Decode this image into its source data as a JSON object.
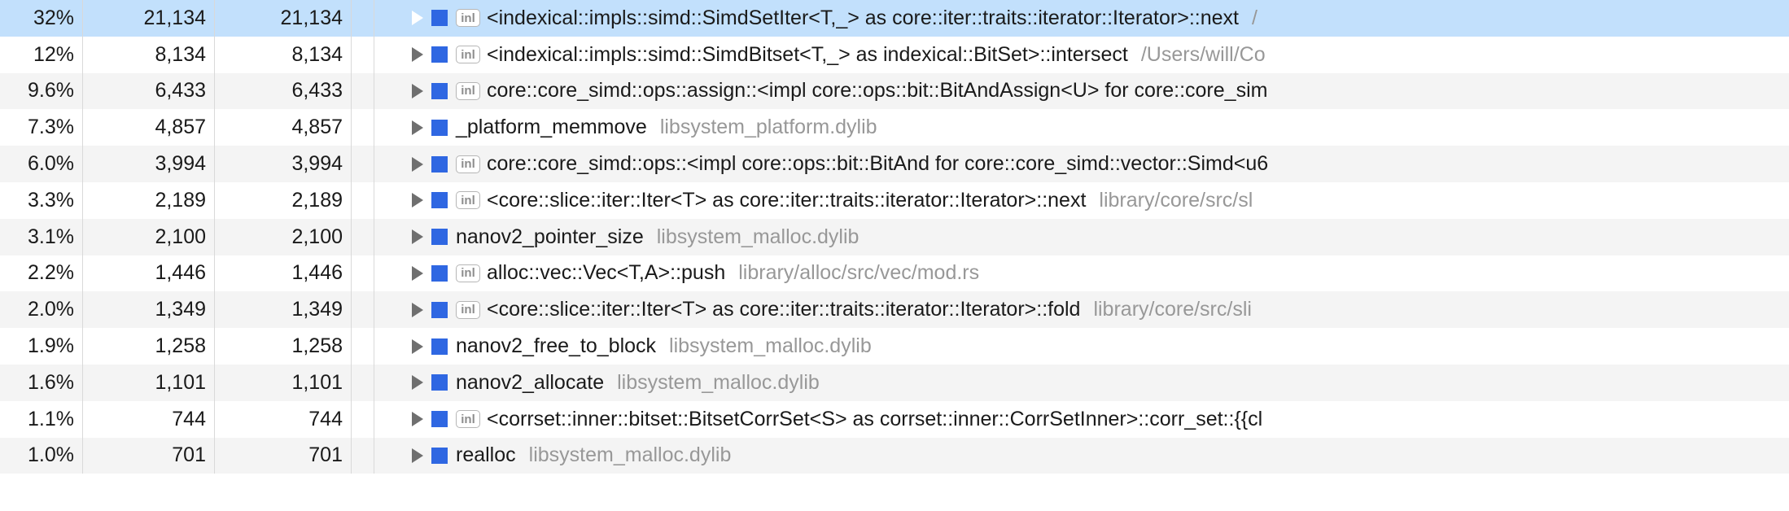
{
  "inl_label": "inl",
  "rows": [
    {
      "selected": true,
      "pct": "32%",
      "c1": "21,134",
      "c2": "21,134",
      "expanded": true,
      "inl": true,
      "symbol": "<indexical::impls::simd::SimdSetIter<T,_> as core::iter::traits::iterator::Iterator>::next",
      "path": "/"
    },
    {
      "selected": false,
      "pct": "12%",
      "c1": "8,134",
      "c2": "8,134",
      "expanded": false,
      "inl": true,
      "symbol": "<indexical::impls::simd::SimdBitset<T,_> as indexical::BitSet>::intersect",
      "path": "/Users/will/Co"
    },
    {
      "selected": false,
      "pct": "9.6%",
      "c1": "6,433",
      "c2": "6,433",
      "expanded": false,
      "inl": true,
      "symbol": "core::core_simd::ops::assign::<impl core::ops::bit::BitAndAssign<U> for core::core_sim",
      "path": ""
    },
    {
      "selected": false,
      "pct": "7.3%",
      "c1": "4,857",
      "c2": "4,857",
      "expanded": false,
      "inl": false,
      "symbol": "_platform_memmove",
      "path": "libsystem_platform.dylib"
    },
    {
      "selected": false,
      "pct": "6.0%",
      "c1": "3,994",
      "c2": "3,994",
      "expanded": false,
      "inl": true,
      "symbol": "core::core_simd::ops::<impl core::ops::bit::BitAnd for core::core_simd::vector::Simd<u6",
      "path": ""
    },
    {
      "selected": false,
      "pct": "3.3%",
      "c1": "2,189",
      "c2": "2,189",
      "expanded": false,
      "inl": true,
      "symbol": "<core::slice::iter::Iter<T> as core::iter::traits::iterator::Iterator>::next",
      "path": "library/core/src/sl"
    },
    {
      "selected": false,
      "pct": "3.1%",
      "c1": "2,100",
      "c2": "2,100",
      "expanded": false,
      "inl": false,
      "symbol": "nanov2_pointer_size",
      "path": "libsystem_malloc.dylib"
    },
    {
      "selected": false,
      "pct": "2.2%",
      "c1": "1,446",
      "c2": "1,446",
      "expanded": false,
      "inl": true,
      "symbol": "alloc::vec::Vec<T,A>::push",
      "path": "library/alloc/src/vec/mod.rs"
    },
    {
      "selected": false,
      "pct": "2.0%",
      "c1": "1,349",
      "c2": "1,349",
      "expanded": false,
      "inl": true,
      "symbol": "<core::slice::iter::Iter<T> as core::iter::traits::iterator::Iterator>::fold",
      "path": "library/core/src/sli"
    },
    {
      "selected": false,
      "pct": "1.9%",
      "c1": "1,258",
      "c2": "1,258",
      "expanded": false,
      "inl": false,
      "symbol": "nanov2_free_to_block",
      "path": "libsystem_malloc.dylib"
    },
    {
      "selected": false,
      "pct": "1.6%",
      "c1": "1,101",
      "c2": "1,101",
      "expanded": false,
      "inl": false,
      "symbol": "nanov2_allocate",
      "path": "libsystem_malloc.dylib"
    },
    {
      "selected": false,
      "pct": "1.1%",
      "c1": "744",
      "c2": "744",
      "expanded": false,
      "inl": true,
      "symbol": "<corrset::inner::bitset::BitsetCorrSet<S> as corrset::inner::CorrSetInner>::corr_set::{{cl",
      "path": ""
    },
    {
      "selected": false,
      "pct": "1.0%",
      "c1": "701",
      "c2": "701",
      "expanded": false,
      "inl": false,
      "symbol": "realloc",
      "path": "libsystem_malloc.dylib"
    }
  ]
}
